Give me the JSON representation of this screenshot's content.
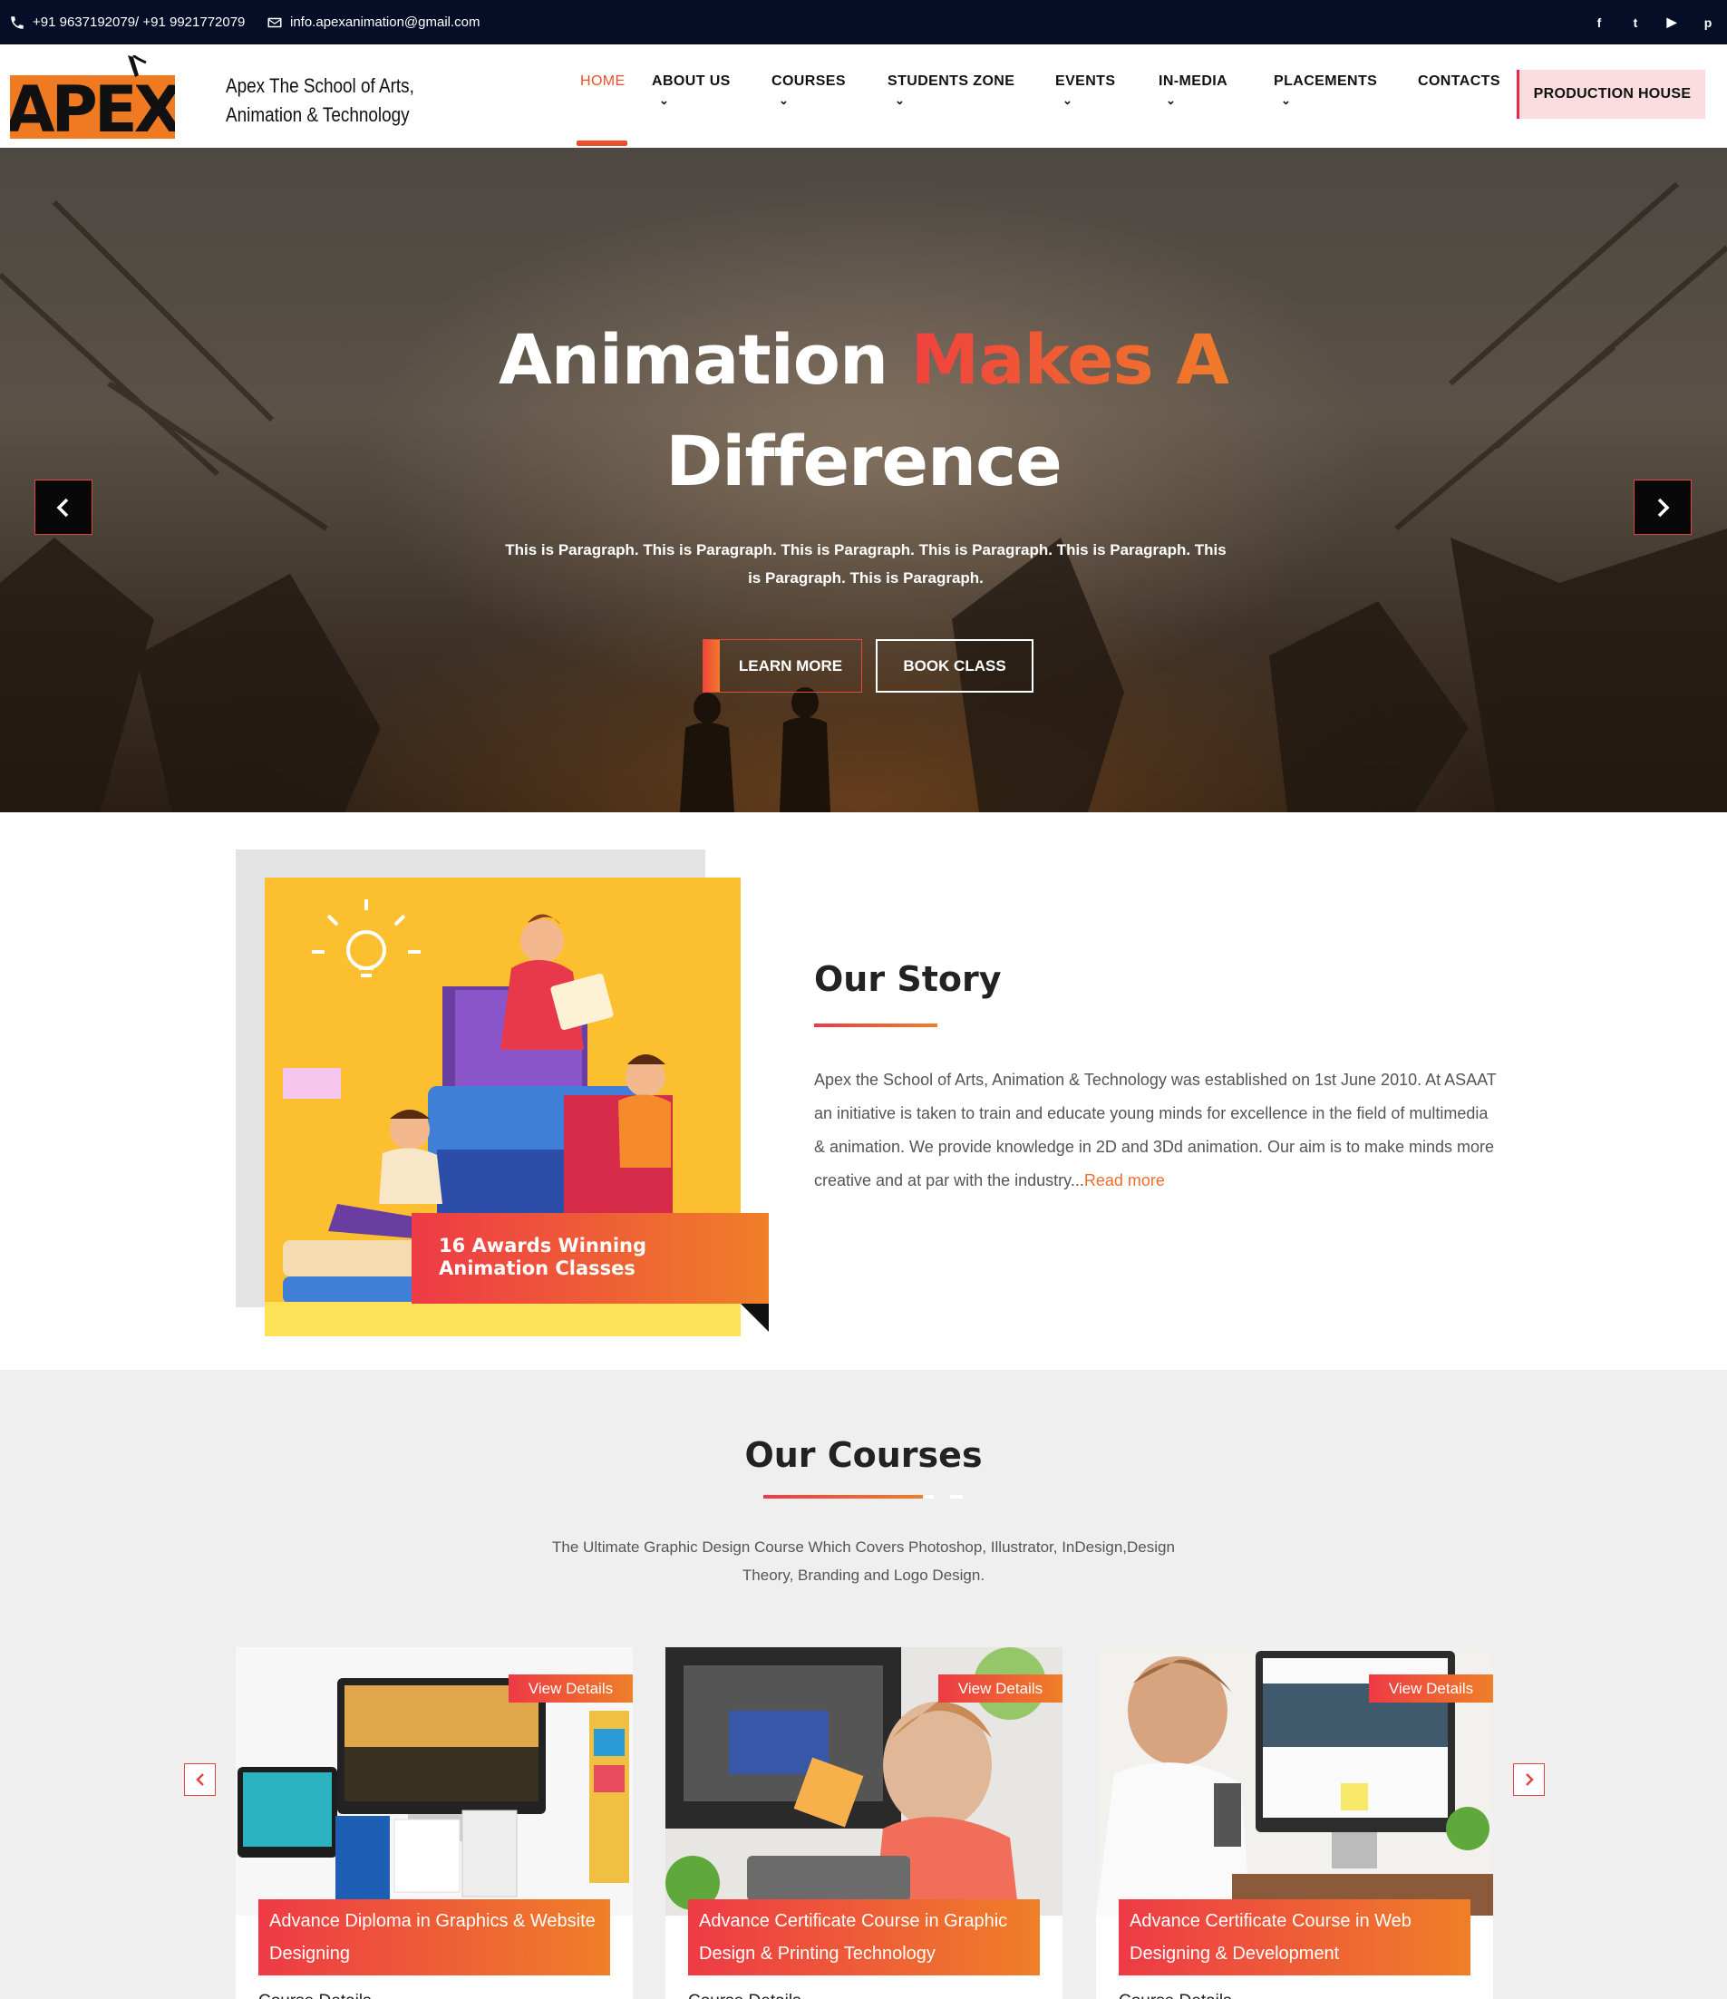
{
  "topbar": {
    "phone": "+91 9637192079/ +91 9921772079",
    "email": "info.apexanimation@gmail.com",
    "social": [
      {
        "icon": "facebook-icon",
        "glyph": "f"
      },
      {
        "icon": "twitter-icon",
        "glyph": "t"
      },
      {
        "icon": "youtube-icon",
        "glyph": "▶"
      },
      {
        "icon": "pinterest-icon",
        "glyph": "p"
      }
    ]
  },
  "header": {
    "logo_text": "APEX",
    "school_name": "Apex The School of Arts, Animation & Technology",
    "nav": [
      {
        "label": "HOME",
        "active": true,
        "dropdown": false
      },
      {
        "label": "ABOUT US",
        "dropdown": true
      },
      {
        "label": "COURSES",
        "dropdown": true
      },
      {
        "label": "STUDENTS ZONE",
        "dropdown": true
      },
      {
        "label": "EVENTS",
        "dropdown": true
      },
      {
        "label": "IN-MEDIA",
        "dropdown": true
      },
      {
        "label": "PLACEMENTS",
        "dropdown": true
      },
      {
        "label": "CONTACTS",
        "dropdown": false
      }
    ],
    "cta": "PRODUCTION HOUSE"
  },
  "hero": {
    "title_part1": "Animation ",
    "title_accent": "Makes A",
    "title_part2": "Difference",
    "paragraph": "This is Paragraph. This is Paragraph. This is Paragraph. This is Paragraph. This is Paragraph. This is Paragraph. This is Paragraph.",
    "learn_more": "LEARN MORE",
    "book_class": "BOOK CLASS"
  },
  "story": {
    "badge": "16 Awards Winning Animation Classes",
    "title": "Our Story",
    "text": "Apex the School of Arts, Animation & Technology was established on 1st June 2010. At ASAAT an initiative is taken to train and educate young minds for excellence in the field of multimedia & animation. We provide knowledge in 2D and 3Dd animation. Our aim is to make minds more creative and at par with the industry...",
    "read_more": "Read more"
  },
  "courses": {
    "title": "Our Courses",
    "subtitle": "The Ultimate Graphic Design Course Which Covers Photoshop, Illustrator, InDesign,Design Theory, Branding and Logo Design.",
    "items": [
      {
        "view": "View Details",
        "name": "Advance Diploma in Graphics & Website Designing",
        "details": "Course Details"
      },
      {
        "view": "View Details",
        "name": "Advance Certificate Course in Graphic Design & Printing Technology",
        "details": "Course Details"
      },
      {
        "view": "View Details",
        "name": "Advance Certificate Course in Web Designing & Development",
        "details": "Course Details"
      }
    ]
  },
  "colors": {
    "accent_red": "#ee3a46",
    "accent_orange": "#ef7f28",
    "topbar_bg": "#050e26",
    "cta_bg": "#fbdde0"
  }
}
